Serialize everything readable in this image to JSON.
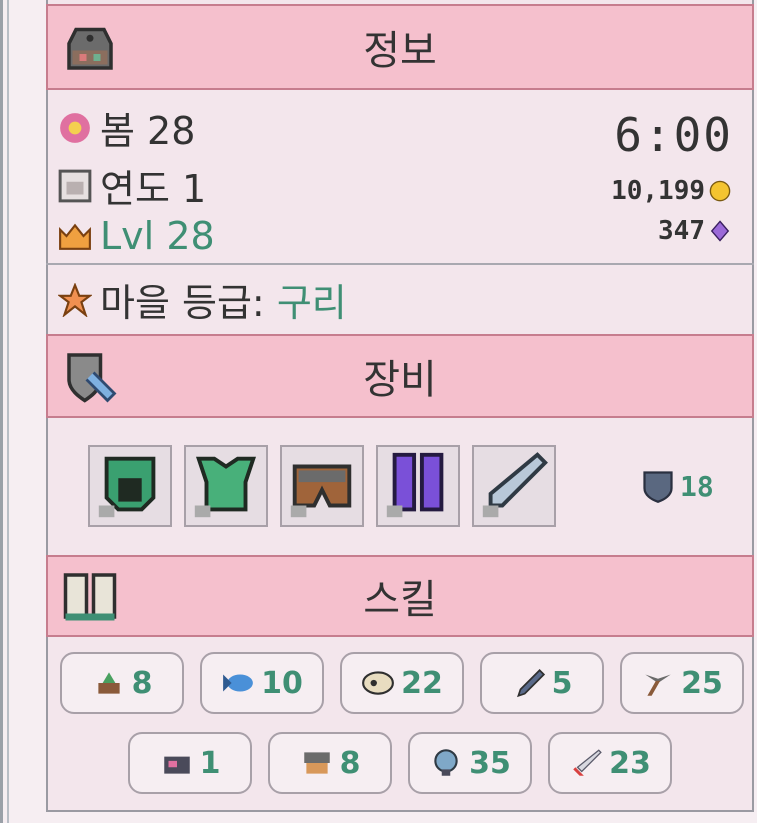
{
  "info": {
    "title": "정보",
    "season": "봄 28",
    "year": "연도 1",
    "level_prefix": "Lvl",
    "level": "28",
    "time": "6:00",
    "gold": "10,199",
    "gems": "347",
    "town_rank_label": "마을 등급:",
    "town_rank_value": "구리"
  },
  "equipment": {
    "title": "장비",
    "slots": [
      "helmet",
      "chest",
      "pants",
      "boots",
      "weapon"
    ],
    "armor": "18"
  },
  "skills": {
    "title": "스킬",
    "items": [
      {
        "icon": "farming-icon",
        "value": "8"
      },
      {
        "icon": "fishing-icon",
        "value": "10"
      },
      {
        "icon": "archaeology-icon",
        "value": "22"
      },
      {
        "icon": "foraging-icon",
        "value": "5"
      },
      {
        "icon": "mining-icon",
        "value": "25"
      },
      {
        "icon": "cooking-icon",
        "value": "1"
      },
      {
        "icon": "ranching-icon",
        "value": "8"
      },
      {
        "icon": "diving-icon",
        "value": "35"
      },
      {
        "icon": "combat-icon",
        "value": "23"
      }
    ]
  },
  "colors": {
    "header": "#f5c0cd",
    "accent_green": "#3f8f74"
  }
}
